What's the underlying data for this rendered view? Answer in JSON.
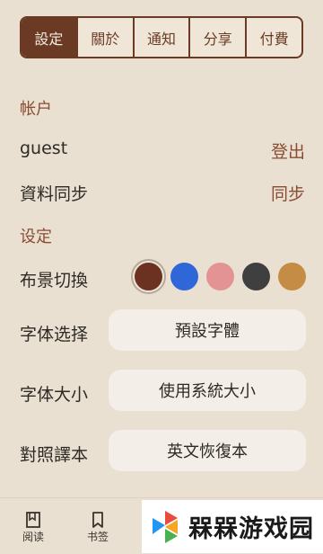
{
  "tabs": [
    {
      "label": "設定",
      "active": true
    },
    {
      "label": "關於",
      "active": false
    },
    {
      "label": "通知",
      "active": false
    },
    {
      "label": "分享",
      "active": false
    },
    {
      "label": "付費",
      "active": false
    }
  ],
  "account": {
    "section_title": "帐户",
    "username": "guest",
    "logout_label": "登出",
    "sync_label": "資料同步",
    "sync_action": "同步"
  },
  "settings": {
    "section_title": "设定",
    "background_label": "布景切換",
    "background_colors": [
      "#6b3222",
      "#2f67d8",
      "#e39393",
      "#3f3f3f",
      "#c48c45"
    ],
    "background_selected": 0,
    "font_label": "字体选择",
    "font_value": "預設字體",
    "fontsize_label": "字体大小",
    "fontsize_value": "使用系統大小",
    "compare_label": "對照譯本",
    "compare_value": "英文恢復本"
  },
  "bottom_nav": {
    "read_label": "阅读",
    "bookmark_label": "书签"
  },
  "watermark": {
    "text": "槑槑游戏园",
    "logo_colors": [
      "#e94b3c",
      "#f6a623",
      "#4caf50",
      "#2196f3"
    ]
  }
}
